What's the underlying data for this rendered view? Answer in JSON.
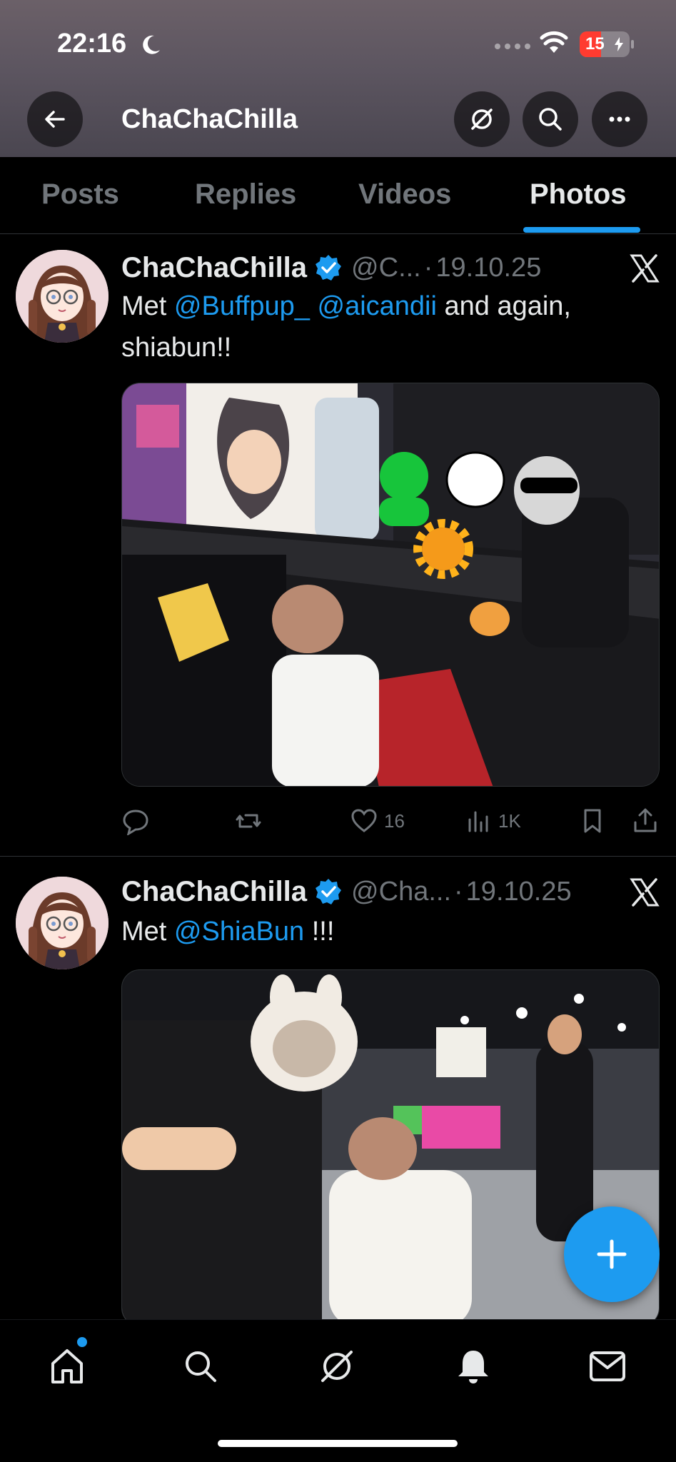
{
  "status_bar": {
    "time": "22:16",
    "battery": "15"
  },
  "header": {
    "title": "ChaChaChilla"
  },
  "tabs": [
    {
      "label": "Posts",
      "active": false
    },
    {
      "label": "Replies",
      "active": false
    },
    {
      "label": "Videos",
      "active": false
    },
    {
      "label": "Photos",
      "active": true
    }
  ],
  "posts": [
    {
      "display_name": "ChaChaChilla",
      "handle": "@C...",
      "date": "19.10.25",
      "text_prefix": "Met ",
      "mention1": "@Buffpup_",
      "mention2": "@aicandii",
      "text_suffix": " and again, shiabun!!",
      "likes": "16",
      "views": "1K"
    },
    {
      "display_name": "ChaChaChilla",
      "handle": "@Cha...",
      "date": "19.10.25",
      "text_prefix": "Met ",
      "mention1": "@ShiaBun",
      "text_suffix": " !!!"
    }
  ],
  "colors": {
    "accent": "#1d9bf0",
    "bg": "#000000",
    "muted": "#71767b",
    "text": "#e7e9ea"
  }
}
